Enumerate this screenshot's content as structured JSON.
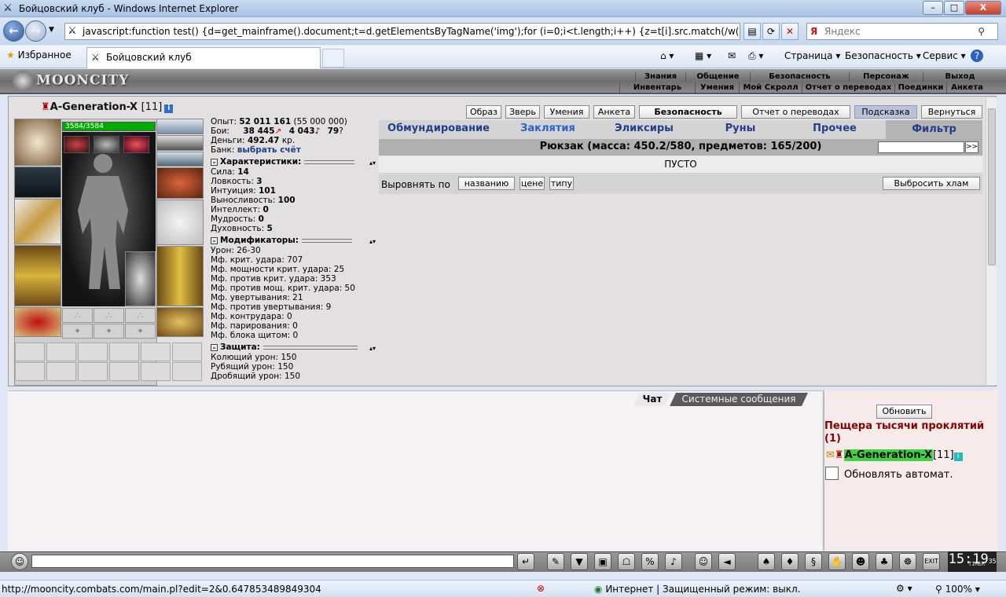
{
  "window": {
    "title": "Бойцовский клуб - Windows Internet Explorer",
    "min": "–",
    "max": "□",
    "close": "X"
  },
  "address": {
    "value": "javascript:function test() {d=get_mainframe().document;t=d.getElementsByTagName('img');for (i=0;i<t.length;i++) {z=t[i].src.match(/w([0-9]+)\\.gif/);if (z)",
    "search_placeholder": "Яндекс"
  },
  "favbar": {
    "favorites": "Избранное",
    "tab_title": "Бойцовский клуб"
  },
  "commandbar": {
    "page": "Страница",
    "safety": "Безопасность",
    "service": "Сервис",
    "help": "?"
  },
  "game": {
    "logo": "MOONCITY",
    "nav_top": [
      "Знания",
      "Общение",
      "Безопасность",
      "Персонаж",
      "Выход"
    ],
    "nav_bottom": [
      "Инвентарь",
      "Умения",
      "Мой Скролл",
      "Отчет о переводах",
      "Поединки",
      "Анкета"
    ]
  },
  "character": {
    "name": "A-Generation-X",
    "level": "[11]",
    "info": "i",
    "hp": "3584/3584"
  },
  "stats": {
    "exp_label": "Опыт:",
    "exp": "52 011 161",
    "exp_next": "(55 000 000)",
    "fights_label": "Бои:",
    "wins": "38 445",
    "losses": "4 043",
    "draws": "79",
    "money_label": "Деньги:",
    "money": "492.47",
    "money_unit": "кр.",
    "bank_label": "Банк:",
    "bank": "выбрать счёт",
    "sec_chars": "Характеристики:",
    "chars": [
      {
        "label": "Сила:",
        "value": "14"
      },
      {
        "label": "Ловкость:",
        "value": "3"
      },
      {
        "label": "Интуиция:",
        "value": "101"
      },
      {
        "label": "Выносливость:",
        "value": "100"
      },
      {
        "label": "Интеллект:",
        "value": "0"
      },
      {
        "label": "Мудрость:",
        "value": "0"
      },
      {
        "label": "Духовность:",
        "value": "5"
      }
    ],
    "sec_mods": "Модификаторы:",
    "mods": [
      "Урон: 26-30",
      "Мф. крит. удара: 707",
      "Мф. мощности крит. удара: 25",
      "Мф. против крит. удара: 353",
      "Мф. против мощ. крит. удара: 50",
      "Мф. увертывания: 21",
      "Мф. против увертывания: 9",
      "Мф. контрудара: 0",
      "Мф. парирования: 0",
      "Мф. блока щитом: 0"
    ],
    "sec_def": "Защита:",
    "defs": [
      "Колющий урон: 150",
      "Рубящий урон: 150",
      "Дробящий урон: 150"
    ]
  },
  "buttons": {
    "image": "Образ",
    "beast": "Зверь",
    "skills": "Умения",
    "anketa": "Анкета",
    "security": "Безопасность",
    "transfers": "Отчет о переводах",
    "hint": "Подсказка",
    "back": "Вернуться"
  },
  "inventory": {
    "tabs": [
      "Обмундирование",
      "Заклятия",
      "Эликсиры",
      "Руны",
      "Прочее"
    ],
    "filter": "Фильтр",
    "header": "Рюкзак (масса: 450.2/580, предметов: 165/200)",
    "go": ">>",
    "empty": "ПУСТО",
    "sort_label": "Выровнять по",
    "sort_name": "названию",
    "sort_price": "цене",
    "sort_type": "типу",
    "junk": "Выбросить хлам"
  },
  "chat": {
    "tab_chat": "Чат",
    "tab_sys": "Системные сообщения",
    "refresh": "Обновить",
    "room": "Пещера тысячи проклятий (1)",
    "user": "A-Generation-X",
    "user_level": "[11]",
    "auto": "Обновлять автомат."
  },
  "clock": {
    "time": "15:19",
    "sec": "35",
    "label": "TIMER"
  },
  "status": {
    "url": "http://mooncity.combats.com/main.pl?edit=2&0.647853489849304",
    "zone": "Интернет | Защищенный режим: выкл.",
    "zoom": "100%"
  }
}
